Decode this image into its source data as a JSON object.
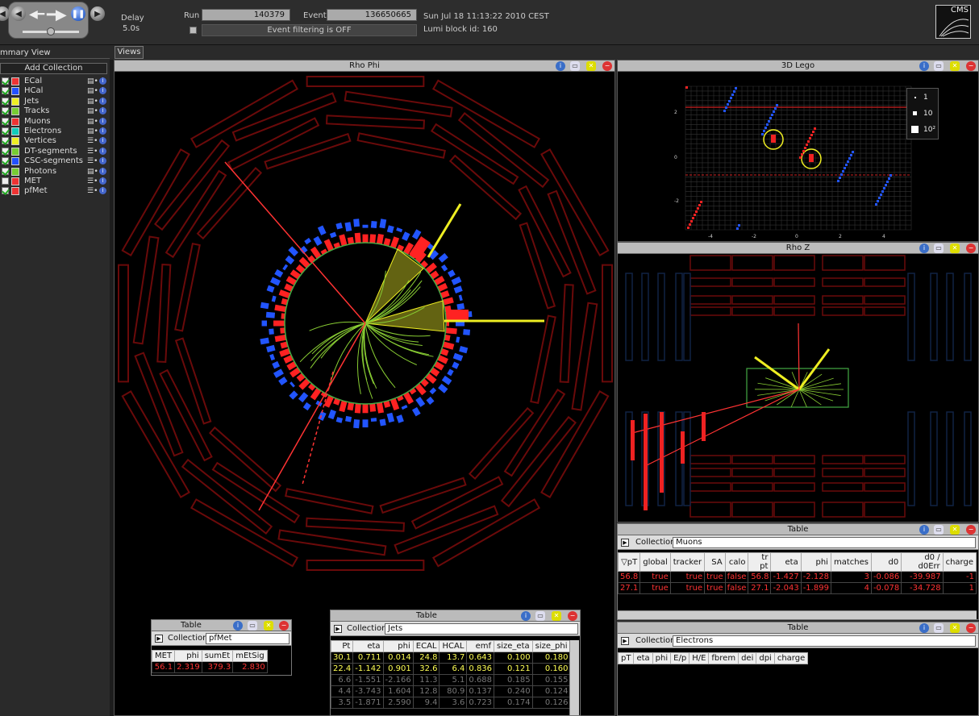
{
  "toolbar": {
    "delay_label": "Delay",
    "delay_value": "5.0s",
    "run_label": "Run",
    "run_value": "140379",
    "event_label": "Event",
    "event_value": "136650665",
    "filter_text": "Event filtering is OFF",
    "datetime": "Sun Jul 18 11:13:22 2010 CEST",
    "lumi": "Lumi block id: 160",
    "logo": "CMS"
  },
  "tabs": {
    "summary": "mmary View",
    "views": "Views"
  },
  "sidebar": {
    "add_collection": "Add Collection",
    "items": [
      {
        "label": "ECal",
        "color": "#e33",
        "checked": true,
        "glyph": "▤•"
      },
      {
        "label": "HCal",
        "color": "#2250ff",
        "checked": true,
        "glyph": "▤•"
      },
      {
        "label": "Jets",
        "color": "#ee2",
        "checked": true,
        "glyph": "▤•"
      },
      {
        "label": "Tracks",
        "color": "#7c3",
        "checked": true,
        "glyph": "▤•"
      },
      {
        "label": "Muons",
        "color": "#e33",
        "checked": true,
        "glyph": "▤•"
      },
      {
        "label": "Electrons",
        "color": "#1cb",
        "checked": true,
        "glyph": "▤•"
      },
      {
        "label": "Vertices",
        "color": "#ee2",
        "checked": true,
        "glyph": "☰•"
      },
      {
        "label": "DT-segments",
        "color": "#7c3",
        "checked": true,
        "glyph": "☰•"
      },
      {
        "label": "CSC-segments",
        "color": "#2250ff",
        "checked": true,
        "glyph": "☰•"
      },
      {
        "label": "Photons",
        "color": "#7c3",
        "checked": true,
        "glyph": "▤•"
      },
      {
        "label": "MET",
        "color": "#e33",
        "checked": false,
        "glyph": "☰•"
      },
      {
        "label": "pfMet",
        "color": "#e33",
        "checked": true,
        "glyph": "☰•"
      }
    ]
  },
  "views": {
    "rho_phi": "Rho Phi",
    "lego": "3D Lego",
    "rho_z": "Rho Z",
    "lego_legend": [
      "1",
      "10",
      "10²"
    ],
    "lego_yticks": [
      "2",
      "0",
      "-2"
    ],
    "lego_xticks": [
      "-4",
      "-2",
      "0",
      "2",
      "4"
    ]
  },
  "met_table": {
    "title": "Table",
    "collection_label": "Collection",
    "collection_value": "pfMet",
    "headers": [
      "MET",
      "phi",
      "sumEt",
      "mEtSig"
    ],
    "rows": [
      [
        "56.1",
        "2.319",
        "379.3",
        "2.830"
      ]
    ]
  },
  "jets_table": {
    "title": "Table",
    "collection_label": "Collection",
    "collection_value": "Jets",
    "headers": [
      "Pt",
      "eta",
      "phi",
      "ECAL",
      "HCAL",
      "emf",
      "size_eta",
      "size_phi"
    ],
    "rows": [
      [
        "30.1",
        "0.711",
        "0.014",
        "24.8",
        "13.7",
        "0.643",
        "0.100",
        "0.180"
      ],
      [
        "22.4",
        "-1.142",
        "0.901",
        "32.6",
        "6.4",
        "0.836",
        "0.121",
        "0.160"
      ],
      [
        "6.6",
        "-1.551",
        "-2.166",
        "11.3",
        "5.1",
        "0.688",
        "0.185",
        "0.155"
      ],
      [
        "4.4",
        "-3.743",
        "1.604",
        "12.8",
        "80.9",
        "0.137",
        "0.240",
        "0.124"
      ],
      [
        "3.5",
        "-1.871",
        "2.590",
        "9.4",
        "3.6",
        "0.723",
        "0.174",
        "0.126"
      ]
    ]
  },
  "muons_table": {
    "title": "Table",
    "collection_label": "Collection",
    "collection_value": "Muons",
    "headers": [
      "▽pT",
      "global",
      "tracker",
      "SA",
      "calo",
      "tr pt",
      "eta",
      "phi",
      "matches",
      "d0",
      "d0 / d0Err",
      "charge"
    ],
    "rows": [
      [
        "56.8",
        "true",
        "true",
        "true",
        "false",
        "56.8",
        "-1.427",
        "-2.128",
        "3",
        "-0.086",
        "-39.987",
        "-1"
      ],
      [
        "27.1",
        "true",
        "true",
        "true",
        "false",
        "27.1",
        "-2.043",
        "-1.899",
        "4",
        "-0.078",
        "-34.728",
        "1"
      ]
    ]
  },
  "electrons_table": {
    "title": "Table",
    "collection_label": "Collection",
    "collection_value": "Electrons",
    "headers": [
      "pT",
      "eta",
      "phi",
      "E/p",
      "H/E",
      "fbrem",
      "dei",
      "dpi",
      "charge"
    ]
  },
  "colors": {
    "ecal": "#ff2222",
    "hcal": "#2255ff",
    "jet": "#eeee22",
    "track": "#88cc33",
    "muon": "#ff3333",
    "geometry": "#6a0a0a"
  }
}
